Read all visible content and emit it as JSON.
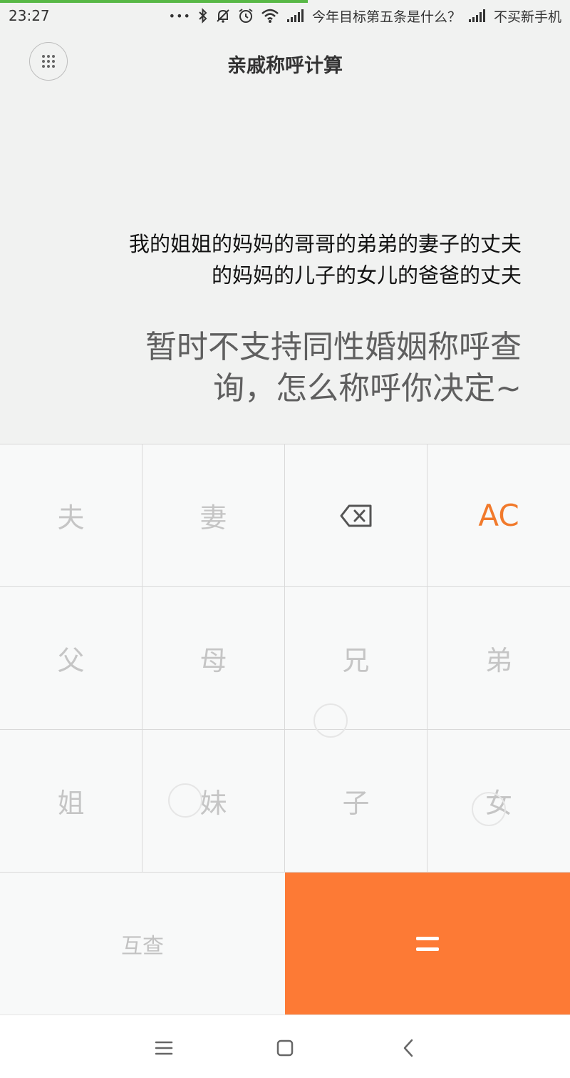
{
  "status_bar": {
    "time": "23:27",
    "dots": "•••",
    "notification_text": "今年目标第五条是什么？",
    "carrier_text": "不买新手机",
    "progress_percent": 54
  },
  "header": {
    "title": "亲戚称呼计算",
    "menu_icon": "grid-dots-icon"
  },
  "display": {
    "expression_line1": "我的姐姐的妈妈的哥哥的弟弟的妻子的丈夫",
    "expression_line2": "的妈妈的儿子的女儿的爸爸的丈夫",
    "result_line1": "暂时不支持同性婚姻称呼查",
    "result_line2": "询，怎么称呼你决定~"
  },
  "keys": {
    "husband": "夫",
    "wife": "妻",
    "backspace_icon": "backspace-icon",
    "clear": "AC",
    "father": "父",
    "mother": "母",
    "elder_brother": "兄",
    "younger_brother": "弟",
    "elder_sister": "姐",
    "younger_sister": "妹",
    "son": "子",
    "daughter": "女",
    "mutual_lookup": "互查",
    "equals": "="
  },
  "colors": {
    "accent": "#fd7a35",
    "ac_text": "#f17a2c",
    "progress": "#58b846"
  },
  "nav_bar": {
    "menu_icon": "menu-lines-icon",
    "home_icon": "home-square-icon",
    "back_icon": "back-chevron-icon"
  }
}
